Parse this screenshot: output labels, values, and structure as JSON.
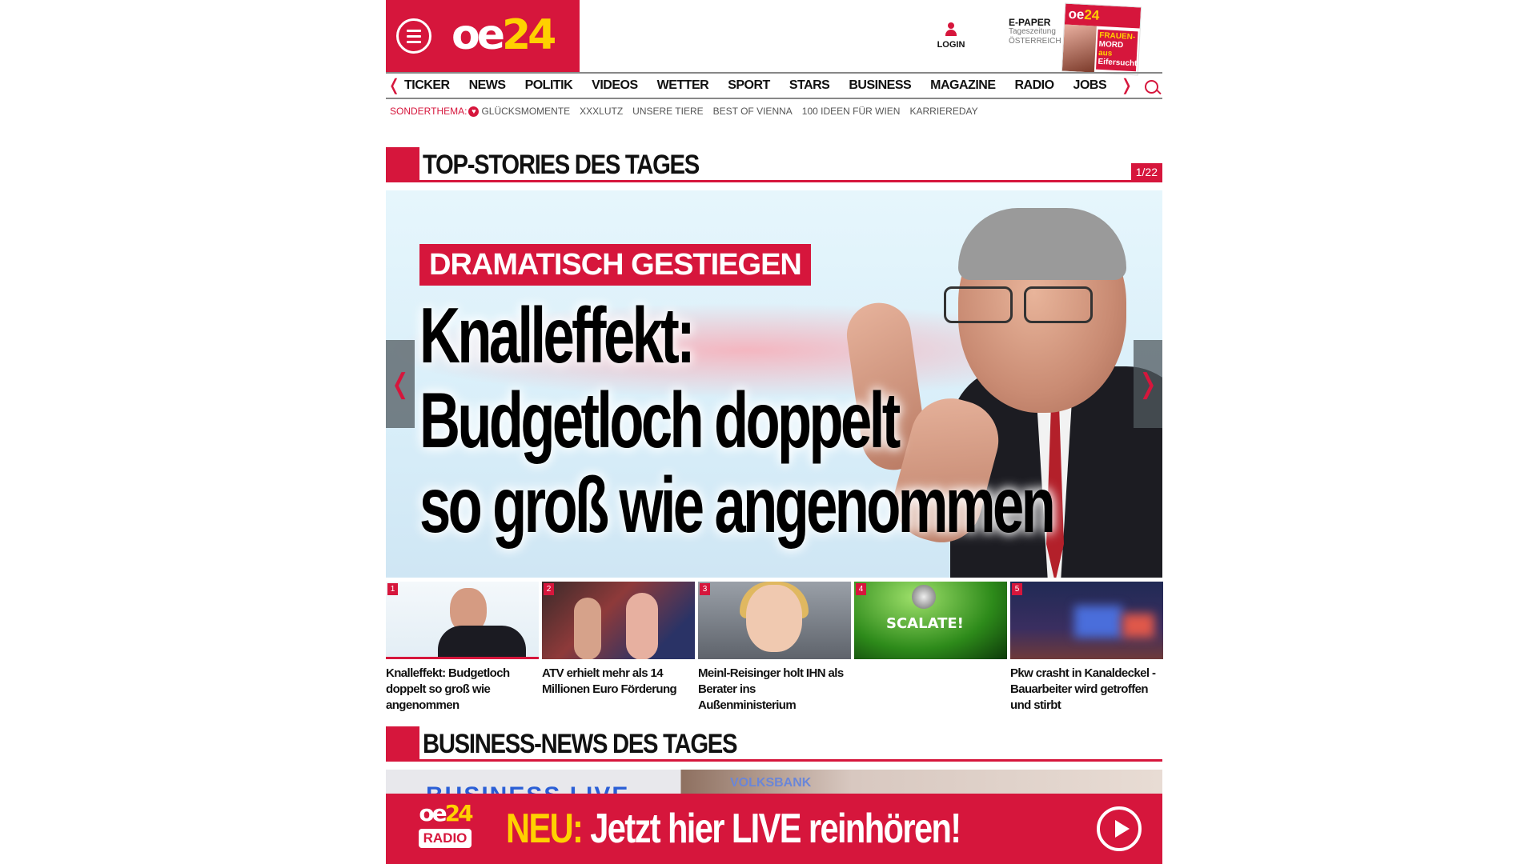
{
  "brand": {
    "logo_main": "oe",
    "logo_accent": "24",
    "accent_color": "#d6163c",
    "accent_yellow": "#ffd100"
  },
  "header": {
    "menu_icon": "hamburger-icon",
    "login_label": "LOGIN",
    "epaper_title": "E-PAPER",
    "epaper_sub1": "Tageszeitung",
    "epaper_sub2": "ÖSTERREICH",
    "cover_logo_main": "oe",
    "cover_logo_accent": "24",
    "cover_head_1": "FRAUEN-",
    "cover_head_2": "MORD",
    "cover_head_3": "aus",
    "cover_head_4": "Eifersucht"
  },
  "nav": {
    "items": [
      "TICKER",
      "NEWS",
      "POLITIK",
      "VIDEOS",
      "WETTER",
      "SPORT",
      "STARS",
      "BUSINESS",
      "MAGAZINE",
      "RADIO",
      "JOBS"
    ],
    "prev_icon": "chevron-left-icon",
    "next_icon": "chevron-right-icon",
    "search_icon": "search-icon"
  },
  "subnav": {
    "sonder_label": "SONDERTHEMA:",
    "items": [
      "GLÜCKSMOMENTE",
      "XXXLUTZ",
      "UNSERE TIERE",
      "BEST OF VIENNA",
      "100 IDEEN FÜR WIEN",
      "KARRIEREDAY"
    ]
  },
  "top_stories": {
    "title": "TOP-STORIES DES TAGES",
    "counter": "1/22",
    "hero": {
      "kicker": "DRAMATISCH GESTIEGEN",
      "title_line1": "Knalleffekt:",
      "title_line2": "Budgetloch doppelt",
      "title_line3": "so groß wie angenommen"
    },
    "thumbs": [
      {
        "num": "1",
        "title": "Knalleffekt: Budgetloch doppelt so groß wie angenommen"
      },
      {
        "num": "2",
        "title": "ATV erhielt mehr als 14 Millionen Euro Förderung"
      },
      {
        "num": "3",
        "title": "Meinl-Reisinger holt IHN als Berater ins Außenministerium"
      },
      {
        "num": "4",
        "title": "",
        "image_text": "SCALATE!"
      },
      {
        "num": "5",
        "title": "Pkw crasht in Kanaldeckel - Bauarbeiter wird getroffen und stirbt"
      }
    ]
  },
  "business": {
    "title": "BUSINESS-NEWS DES TAGES",
    "image_text_1": "BUSINESS LIVE",
    "image_text_2": "VOLKSBANK"
  },
  "radio_banner": {
    "logo_main": "oe",
    "logo_accent": "24",
    "logo_label": "RADIO",
    "neu": "NEU:",
    "text": " Jetzt hier LIVE reinhören!",
    "play_icon": "play-icon"
  }
}
